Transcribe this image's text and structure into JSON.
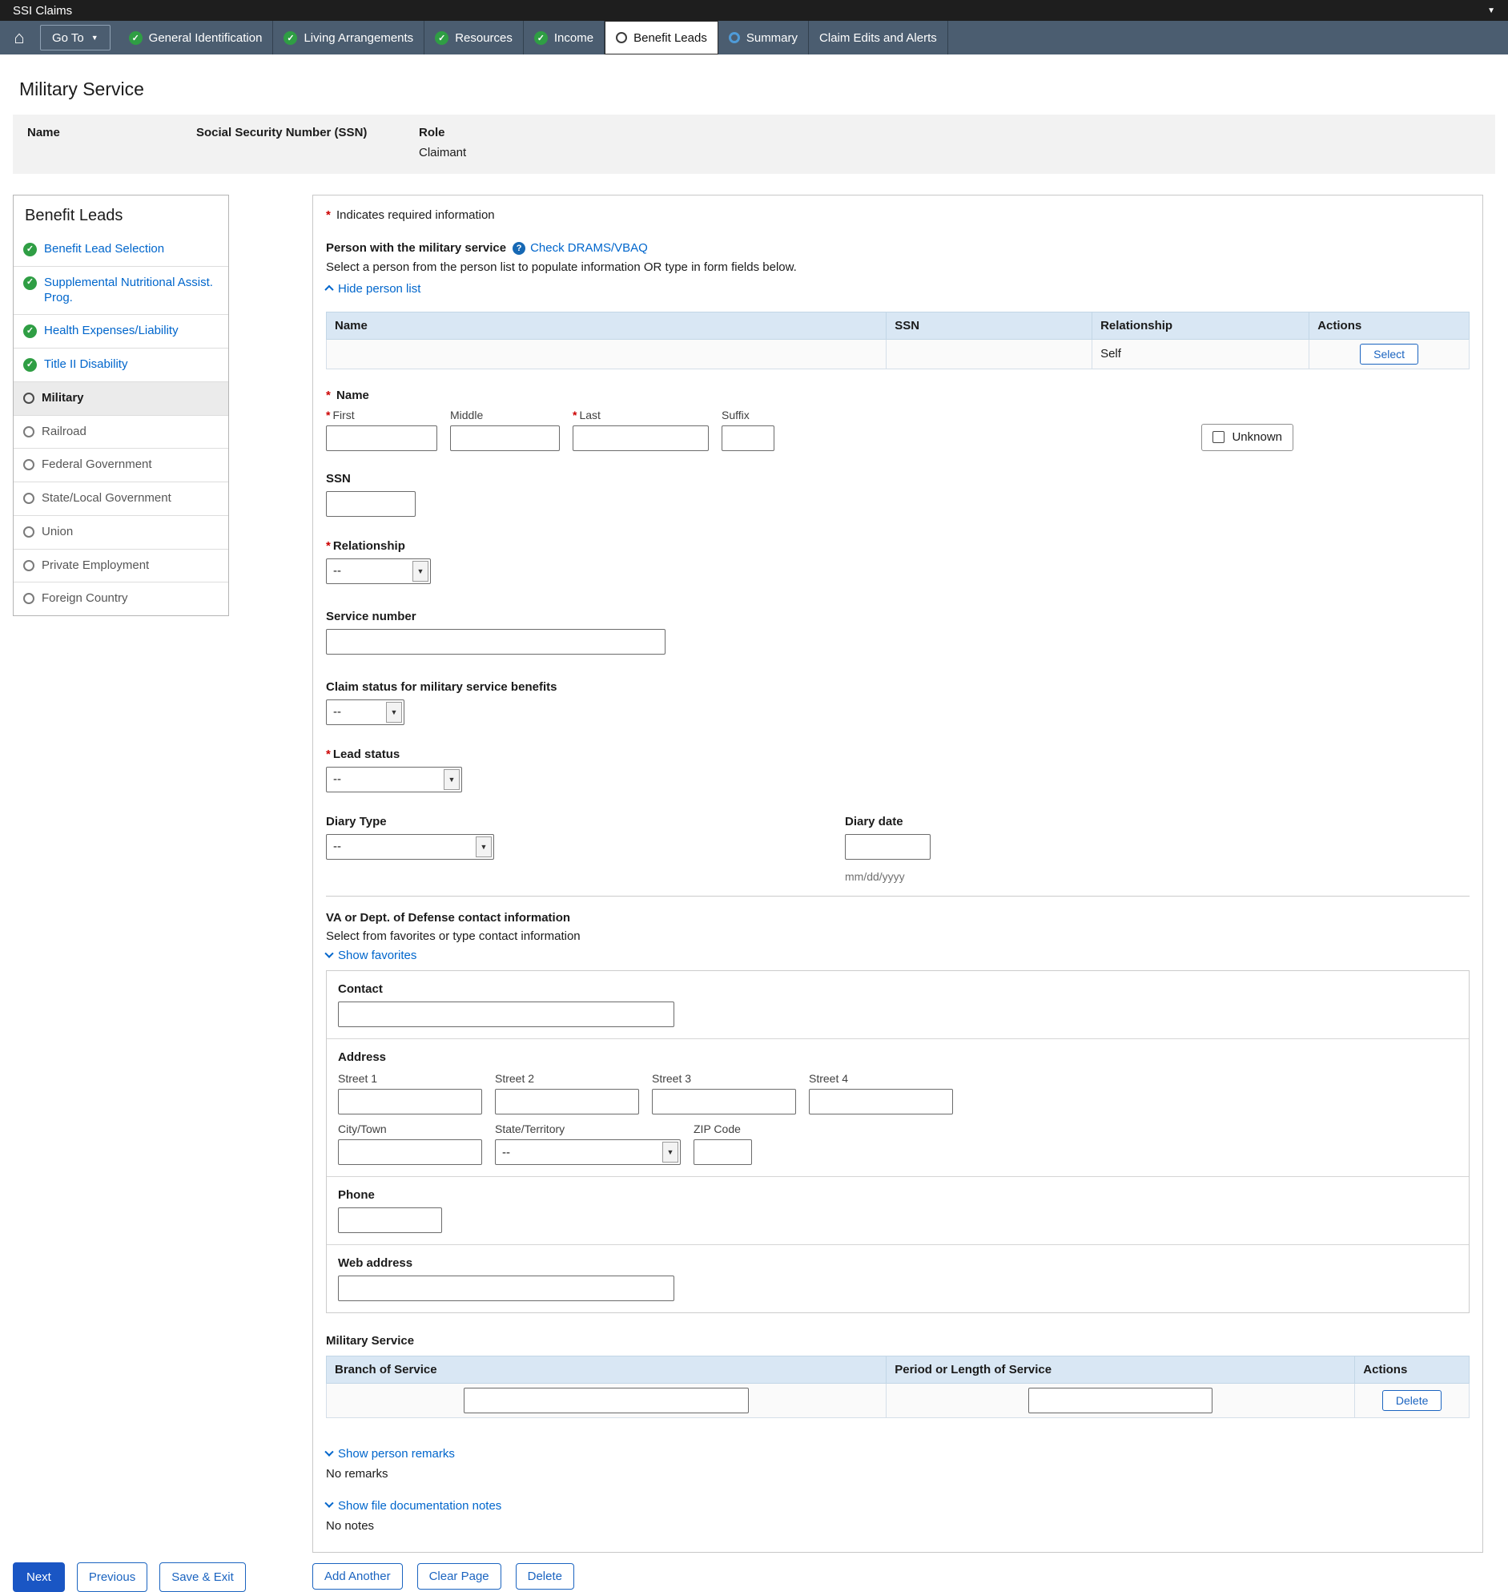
{
  "app": {
    "title": "SSI Claims"
  },
  "icons": {
    "home": "⌂",
    "caret_down": "▼",
    "check": "✓",
    "question": "?"
  },
  "colors": {
    "accent": "#0066cc",
    "nav_bg": "#4b5d70",
    "success_green": "#2f9e44",
    "table_header_bg": "#d9e7f4",
    "required_red": "#cc0000"
  },
  "nav": {
    "goto_label": "Go To",
    "tabs": [
      {
        "label": "General Identification",
        "status": "complete"
      },
      {
        "label": "Living Arrangements",
        "status": "complete"
      },
      {
        "label": "Resources",
        "status": "complete"
      },
      {
        "label": "Income",
        "status": "complete"
      },
      {
        "label": "Benefit Leads",
        "status": "current"
      },
      {
        "label": "Summary",
        "status": "in-progress"
      },
      {
        "label": "Claim Edits and Alerts",
        "status": "none"
      }
    ]
  },
  "page": {
    "title": "Military Service"
  },
  "person_header": {
    "name_label": "Name",
    "ssn_label": "Social Security Number (SSN)",
    "role_label": "Role",
    "role_value": "Claimant"
  },
  "sidebar": {
    "title": "Benefit Leads",
    "items": [
      {
        "label": "Benefit Lead Selection",
        "state": "complete"
      },
      {
        "label": "Supplemental Nutritional Assist. Prog.",
        "state": "complete"
      },
      {
        "label": "Health Expenses/Liability",
        "state": "complete"
      },
      {
        "label": "Title II Disability",
        "state": "complete"
      },
      {
        "label": "Military",
        "state": "current"
      },
      {
        "label": "Railroad",
        "state": "todo"
      },
      {
        "label": "Federal Government",
        "state": "todo"
      },
      {
        "label": "State/Local Government",
        "state": "todo"
      },
      {
        "label": "Union",
        "state": "todo"
      },
      {
        "label": "Private Employment",
        "state": "todo"
      },
      {
        "label": "Foreign Country",
        "state": "todo"
      }
    ]
  },
  "form": {
    "required_note": "Indicates required information",
    "person_section": {
      "label": "Person with the military service",
      "check_link": "Check DRAMS/VBAQ",
      "instruction": "Select a person from the person list to populate information OR type in form fields below.",
      "hide_list_link": "Hide person list",
      "table": {
        "headers": [
          "Name",
          "SSN",
          "Relationship",
          "Actions"
        ],
        "rows": [
          {
            "name": "",
            "ssn": "",
            "relationship": "Self",
            "action": "Select"
          }
        ]
      }
    },
    "name": {
      "group_label": "Name",
      "first_label": "First",
      "middle_label": "Middle",
      "last_label": "Last",
      "suffix_label": "Suffix",
      "unknown_label": "Unknown"
    },
    "ssn_label": "SSN",
    "relationship": {
      "label": "Relationship",
      "value": "--"
    },
    "service_number_label": "Service number",
    "claim_status": {
      "label": "Claim status for military service benefits",
      "value": "--"
    },
    "lead_status": {
      "label": "Lead status",
      "value": "--"
    },
    "diary_type": {
      "label": "Diary Type",
      "value": "--"
    },
    "diary_date": {
      "label": "Diary date",
      "hint": "mm/dd/yyyy"
    },
    "contact_info": {
      "heading": "VA or Dept. of Defense contact information",
      "instruction": "Select from favorites or type contact information",
      "show_favorites_link": "Show favorites",
      "contact_label": "Contact",
      "address": {
        "heading": "Address",
        "street1": "Street 1",
        "street2": "Street 2",
        "street3": "Street 3",
        "street4": "Street 4",
        "city": "City/Town",
        "state": "State/Territory",
        "state_value": "--",
        "zip": "ZIP Code"
      },
      "phone_label": "Phone",
      "web_label": "Web address"
    },
    "military_table": {
      "heading": "Military Service",
      "headers": [
        "Branch of Service",
        "Period or Length of Service",
        "Actions"
      ],
      "row_action": "Delete"
    },
    "remarks": {
      "show_link": "Show person remarks",
      "empty": "No remarks"
    },
    "notes": {
      "show_link": "Show file documentation notes",
      "empty": "No notes"
    }
  },
  "actions": {
    "add_another": "Add Another",
    "clear_page": "Clear Page",
    "delete": "Delete",
    "next": "Next",
    "previous": "Previous",
    "save_exit": "Save & Exit"
  }
}
